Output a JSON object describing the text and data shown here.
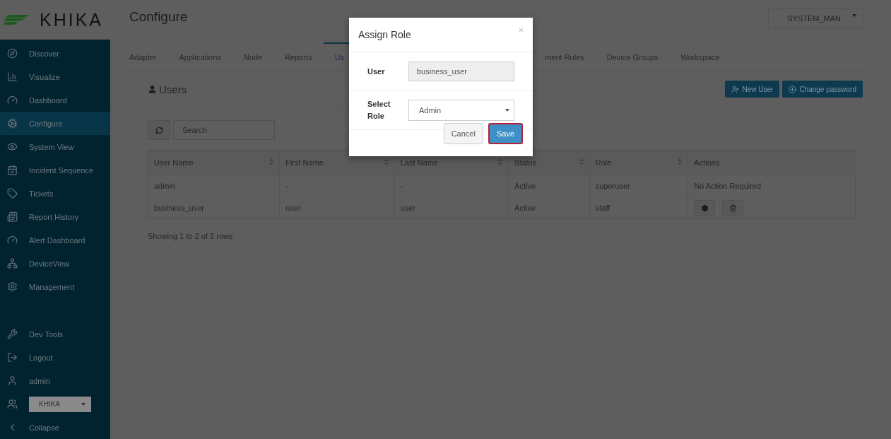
{
  "logo": {
    "text": "KHIKA"
  },
  "page_title": "Configure",
  "system_select": {
    "value": "SYSTEM_MAN"
  },
  "sidebar": {
    "items": [
      {
        "label": "Discover",
        "selected": false
      },
      {
        "label": "Visualize",
        "selected": false
      },
      {
        "label": "Dashboard",
        "selected": false
      },
      {
        "label": "Configure",
        "selected": true
      },
      {
        "label": "System View",
        "selected": false
      },
      {
        "label": "Incident Sequence",
        "selected": false
      },
      {
        "label": "Tickets",
        "selected": false
      },
      {
        "label": "Report History",
        "selected": false
      },
      {
        "label": "Alert Dashboard",
        "selected": false
      },
      {
        "label": "DeviceView",
        "selected": false
      },
      {
        "label": "Management",
        "selected": false
      }
    ],
    "bottom_items": [
      {
        "label": "Dev Tools",
        "kind": "link"
      },
      {
        "label": "Logout",
        "kind": "link"
      },
      {
        "label": "admin",
        "kind": "link"
      },
      {
        "label": "KHIKA",
        "kind": "select"
      },
      {
        "label": "Collapse",
        "kind": "link"
      }
    ]
  },
  "tabs": [
    {
      "label": "Adapter",
      "selected": false
    },
    {
      "label": "Applications",
      "selected": false
    },
    {
      "label": "Node",
      "selected": false
    },
    {
      "label": "Reports",
      "selected": false
    },
    {
      "label": "Us",
      "selected": true
    },
    {
      "label": "ment Rules",
      "selected": false
    },
    {
      "label": "Device Groups",
      "selected": false
    },
    {
      "label": "Workspace",
      "selected": false
    }
  ],
  "users_panel": {
    "title": "Users",
    "buttons": [
      "New User",
      "Change password"
    ],
    "search": {
      "placeholder": "Search"
    },
    "table": {
      "columns": [
        {
          "label": "User Name",
          "sortable": true
        },
        {
          "label": "First Name",
          "sortable": true
        },
        {
          "label": "Last Name",
          "sortable": true
        },
        {
          "label": "Status",
          "sortable": true
        },
        {
          "label": "Role",
          "sortable": true
        },
        {
          "label": "Actions",
          "sortable": false
        }
      ],
      "rows": [
        {
          "cells": [
            "admin",
            "-",
            "-",
            "Active",
            "superuser"
          ],
          "actions": {
            "kind": "text",
            "text": "No Action Required"
          }
        },
        {
          "cells": [
            "business_user",
            "user",
            "user",
            "Active",
            "staff"
          ],
          "actions": {
            "kind": "buttons"
          }
        }
      ]
    },
    "footer": "Showing 1 to 2 of 2 rows"
  },
  "modal": {
    "title": "Assign Role",
    "close": "×",
    "user_label": "User",
    "user_value": "business_user",
    "role_label": "Select Role",
    "role_value": "Admin",
    "buttons": [
      {
        "label": "Cancel",
        "primary": false
      },
      {
        "label": "Save",
        "primary": true
      }
    ]
  }
}
